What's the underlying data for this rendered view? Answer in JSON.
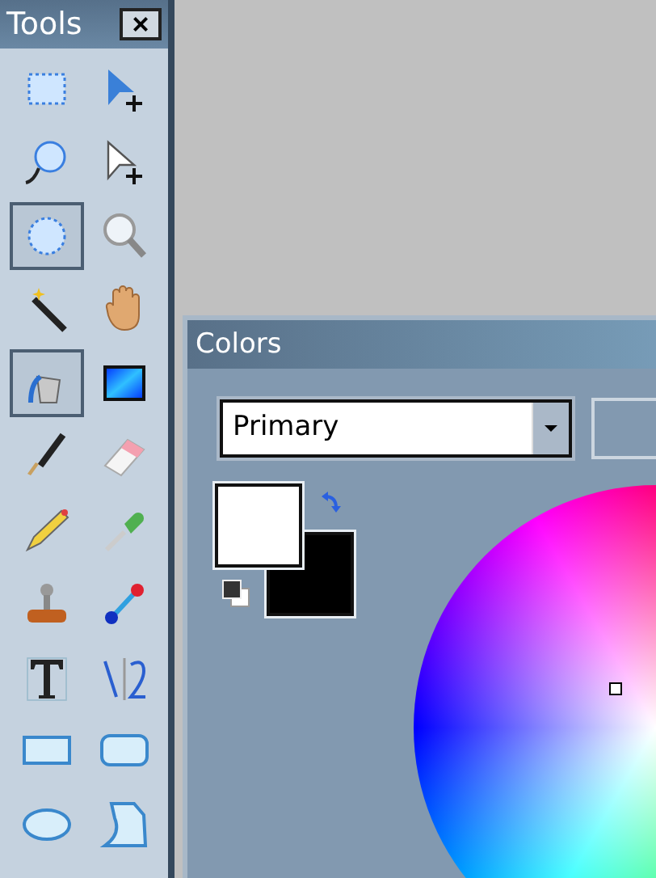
{
  "tools_window": {
    "title": "Tools",
    "close_label": "×",
    "tools": [
      {
        "kind": "rect-select",
        "selected": false
      },
      {
        "kind": "move-pixels",
        "selected": false
      },
      {
        "kind": "lasso",
        "selected": false
      },
      {
        "kind": "move-selection",
        "selected": false
      },
      {
        "kind": "ellipse-select",
        "selected": true
      },
      {
        "kind": "zoom",
        "selected": false
      },
      {
        "kind": "magic-wand",
        "selected": false
      },
      {
        "kind": "pan",
        "selected": false
      },
      {
        "kind": "bucket",
        "selected": true
      },
      {
        "kind": "gradient",
        "selected": false
      },
      {
        "kind": "brush",
        "selected": false
      },
      {
        "kind": "eraser",
        "selected": false
      },
      {
        "kind": "pencil",
        "selected": false
      },
      {
        "kind": "picker",
        "selected": false
      },
      {
        "kind": "stamp",
        "selected": false
      },
      {
        "kind": "recolor",
        "selected": false
      },
      {
        "kind": "text",
        "selected": false
      },
      {
        "kind": "line",
        "selected": false
      },
      {
        "kind": "rectangle",
        "selected": false
      },
      {
        "kind": "rounded-rectangle",
        "selected": false
      },
      {
        "kind": "ellipse",
        "selected": false
      },
      {
        "kind": "freeform",
        "selected": false
      }
    ]
  },
  "colors_window": {
    "title": "Colors",
    "mode": {
      "value": "Primary"
    }
  }
}
